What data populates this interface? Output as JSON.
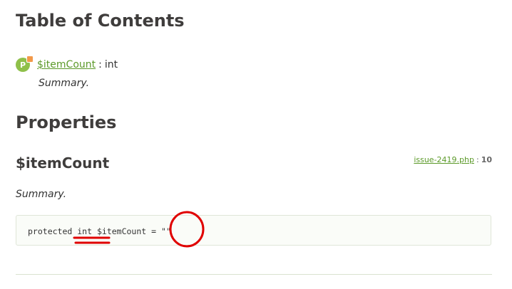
{
  "toc": {
    "heading": "Table of Contents",
    "items": [
      {
        "badge": "P",
        "name": "$itemCount",
        "sep": ":",
        "type": "int",
        "summary": "Summary."
      }
    ]
  },
  "properties": {
    "heading": "Properties",
    "item": {
      "name": "$itemCount",
      "file": "issue-2419.php",
      "file_sep": ":",
      "line": "10",
      "summary": "Summary.",
      "code": {
        "visibility": "protected",
        "type": "int",
        "name": "$itemCount",
        "equals": "=",
        "value": "\"\""
      }
    }
  },
  "colors": {
    "accent": "#5c9a2a",
    "badge": "#8fc04a",
    "badge_mark": "#f2994a",
    "annotation": "#e00000"
  },
  "icons": {
    "property_badge": "property-badge-icon"
  }
}
